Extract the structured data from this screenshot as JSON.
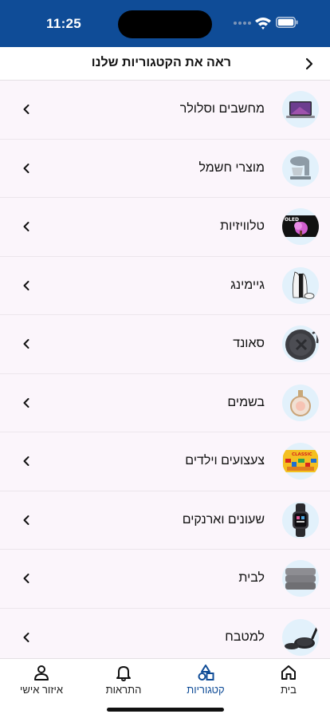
{
  "status_bar": {
    "time": "11:25"
  },
  "header": {
    "title": "ראה את הקטגוריות שלנו"
  },
  "categories": [
    {
      "label": "מחשבים וסלולר",
      "icon": "laptop-icon"
    },
    {
      "label": "מוצרי חשמל",
      "icon": "stand-mixer-icon"
    },
    {
      "label": "טלוויזיות",
      "icon": "television-icon",
      "badge": "OLED"
    },
    {
      "label": "גיימינג",
      "icon": "game-console-icon"
    },
    {
      "label": "סאונד",
      "icon": "speaker-icon"
    },
    {
      "label": "בשמים",
      "icon": "perfume-bottle-icon"
    },
    {
      "label": "צעצועים וילדים",
      "icon": "toy-box-icon",
      "badge": "CLASSIC"
    },
    {
      "label": "שעונים וארנקים",
      "icon": "smartwatch-icon"
    },
    {
      "label": "לבית",
      "icon": "towels-icon"
    },
    {
      "label": "למטבח",
      "icon": "pans-icon"
    }
  ],
  "tabs": [
    {
      "label": "בית",
      "icon": "home-icon",
      "active": false
    },
    {
      "label": "קטגוריות",
      "icon": "categories-icon",
      "active": true
    },
    {
      "label": "התראות",
      "icon": "bell-icon",
      "active": false
    },
    {
      "label": "איזור אישי",
      "icon": "person-icon",
      "active": false
    }
  ],
  "colors": {
    "brand": "#0f4c97",
    "background": "#fbf5fb",
    "thumb_bg": "#e2f1fb"
  }
}
